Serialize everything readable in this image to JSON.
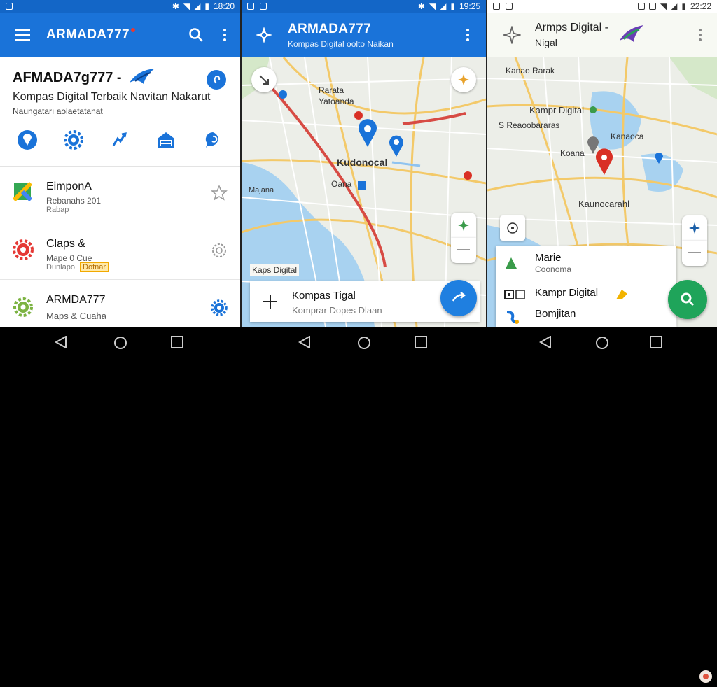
{
  "screen1": {
    "status_time": "18:20",
    "appbar_title": "ARMADA777",
    "hero": {
      "title": "AFMADA7g777 -",
      "line1": "Kompas Digital Terbaik Navitan Nakarut",
      "line2": "Naungatarı aolaetatanat"
    },
    "list": [
      {
        "title": "EimponA",
        "sub1": "Rebanahs 201",
        "sub2": "Rabap"
      },
      {
        "title": "Claps &",
        "sub1": "Mape 0 Cue",
        "sub2": "Dunlapo",
        "badge": "Dotnar"
      },
      {
        "title": "ARMDA777",
        "sub1": "Maps & Cuaha"
      }
    ]
  },
  "screen2": {
    "status_time": "19:25",
    "appbar_title": "ARMADA777",
    "appbar_sub": "Kompas Digital oolto Naikan",
    "map_labels": {
      "a": "Yatoanda",
      "b": "Rarata",
      "c": "Kudonocal",
      "d": "Oana",
      "e": "Majana",
      "f": "Kaps Digital"
    },
    "card": {
      "title": "Kompas Tigal",
      "sub": "Komprar Dopes Dlaan"
    }
  },
  "screen3": {
    "status_time": "22:22",
    "appbar_title": "Armps Digital -",
    "appbar_sub": "Nigal",
    "map_labels": {
      "a": "Kanao Rarak",
      "b": "Kampr Digital",
      "c": "S Reaoobararas",
      "d": "Kanaoca",
      "e": "Kaunocarahl",
      "f": "Koana"
    },
    "list": [
      {
        "title": "Marie",
        "sub": "Coonoma"
      },
      {
        "title": "Kampr Digital"
      },
      {
        "title": "Bomjitan"
      }
    ]
  },
  "colors": {
    "primary": "#1a73d9",
    "fab_blue": "#1f7fe0",
    "fab_green": "#1fa45a",
    "pin_red": "#d93025"
  }
}
